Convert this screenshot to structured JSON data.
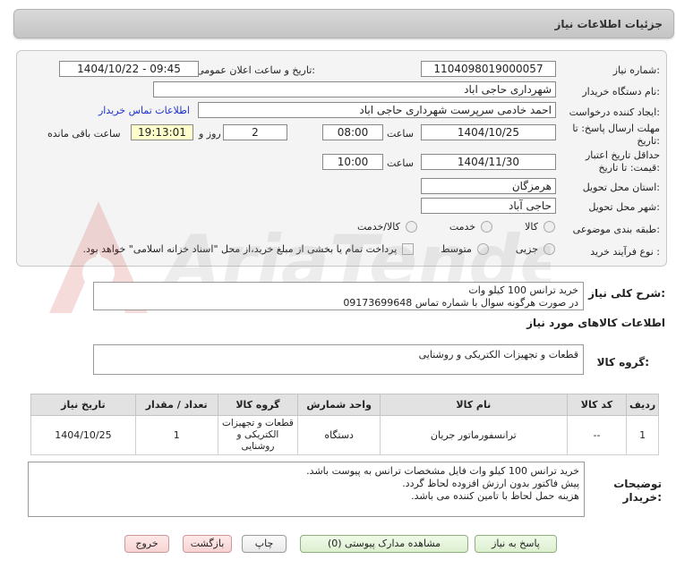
{
  "header": {
    "title": "جزئیات اطلاعات نیاز"
  },
  "form": {
    "need_number_label": "شماره نیاز:",
    "need_number": "1104098019000057",
    "announce_label": "تاریخ و ساعت اعلان عمومی:",
    "announce_value": "1404/10/22 - 09:45",
    "buyer_org_label": "نام دستگاه خریدار:",
    "buyer_org": "شهرداری حاجی اباد",
    "creator_label": "ایجاد کننده درخواست:",
    "creator": "احمد خادمی سرپرست شهرداری حاجی اباد",
    "contact_link": "اطلاعات تماس خریدار",
    "deadline_label_1": "مهلت ارسال پاسخ: تا",
    "deadline_label_2": "تاریخ:",
    "deadline_date": "1404/10/25",
    "time_label": "ساعت",
    "deadline_time": "08:00",
    "days": "2",
    "days_label": "روز و",
    "remaining": "19:13:01",
    "remaining_label": "ساعت باقی مانده",
    "validity_label_1": "حداقل تاریخ اعتبار",
    "validity_label_2": "قیمت: تا تاریخ:",
    "validity_date": "1404/11/30",
    "validity_time": "10:00",
    "province_label": "استان محل تحویل:",
    "province": "هرمزگان",
    "city_label": "شهر محل تحویل:",
    "city": "حاجی آباد",
    "category_label": "طبقه بندی موضوعی:",
    "category_options": [
      "کالا",
      "خدمت",
      "کالا/خدمت"
    ],
    "process_label": "نوع فرآیند خرید :",
    "process_options": [
      "جزیی",
      "متوسط"
    ],
    "payment_note": "پرداخت تمام یا بخشی از مبلغ خرید،از محل \"اسناد خزانه اسلامی\" خواهد بود."
  },
  "description": {
    "label": "شرح کلی نیاز:",
    "line1": "خرید ترانس 100 کیلو وات",
    "line2": "در صورت هرگونه سوال با شماره تماس 09173699648"
  },
  "goods": {
    "section_title": "اطلاعات کالاهای مورد نیاز",
    "group_label": "گروه کالا:",
    "group_value": "قطعات و تجهیزات الکتریکی و روشنایی",
    "columns": [
      "ردیف",
      "کد کالا",
      "نام کالا",
      "واحد شمارش",
      "گروه کالا",
      "تعداد / مقدار",
      "تاریخ نیاز"
    ],
    "rows": [
      {
        "row": "1",
        "code": "--",
        "name": "ترانسفورماتور جریان",
        "unit": "دستگاه",
        "group": "قطعات و تجهیزات الکتریکی و روشنایی",
        "qty": "1",
        "date": "1404/10/25"
      }
    ]
  },
  "buyer_notes": {
    "label_1": "توضیحات",
    "label_2": "خریدار:",
    "line1": "خرید ترانس 100 کیلو وات فایل مشخصات ترانس به پیوست باشد.",
    "line2": "پیش فاکتور بدون ارزش افزوده لحاظ گردد.",
    "line3": "هزینه حمل لحاظ با تامین کننده می باشد."
  },
  "buttons": {
    "reply": "پاسخ به نیاز",
    "view_docs": "مشاهده مدارک پیوستی (0)",
    "print": "چاپ",
    "back": "بازگشت",
    "exit": "خروج"
  },
  "watermark": {
    "text": "AriaTender.net"
  }
}
